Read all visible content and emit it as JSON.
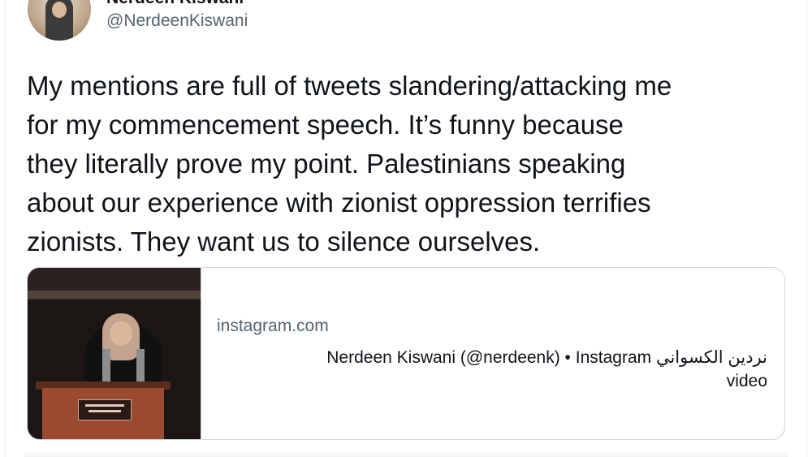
{
  "tweet": {
    "author": {
      "display_name": "Nerdeen Kiswani",
      "handle": "@NerdeenKiswani",
      "avatar_icon": "user-avatar"
    },
    "text": "My mentions are full of tweets slandering/attacking me\nfor my commencement speech. It’s funny because\nthey literally prove my point. Palestinians speaking\nabout our experience with zionist oppression terrifies\nzionists. They want us to silence ourselves.",
    "link_card": {
      "domain": "instagram.com",
      "title": "Nerdeen Kiswani (@nerdeenk) • Instagram نردين الكسواني\nvideo",
      "media_icon": "video-thumbnail"
    }
  },
  "colors": {
    "text_primary": "#0f1419",
    "text_secondary": "#536471",
    "card_border": "#cfd9de"
  }
}
